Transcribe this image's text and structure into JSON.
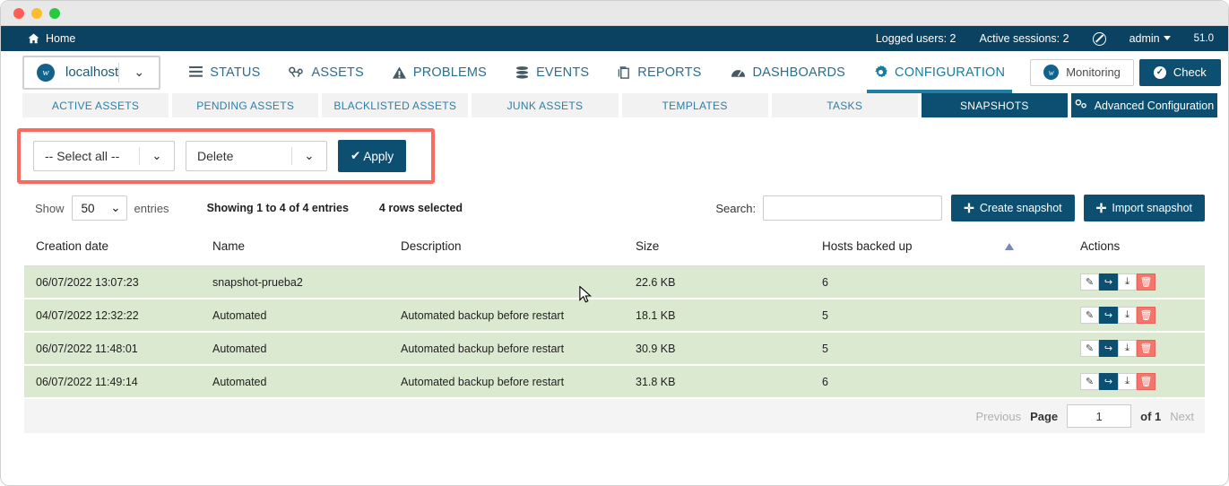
{
  "topbar": {
    "home": "Home",
    "logged_users": "Logged users: 2",
    "active_sessions": "Active sessions: 2",
    "user": "admin",
    "version": "51.0"
  },
  "hostselect": {
    "name": "localhost",
    "logo": "w"
  },
  "nav": {
    "items": [
      {
        "label": "STATUS",
        "icon": "list-icon",
        "active": false
      },
      {
        "label": "ASSETS",
        "icon": "assets-icon",
        "active": false
      },
      {
        "label": "PROBLEMS",
        "icon": "warning-icon",
        "active": false
      },
      {
        "label": "EVENTS",
        "icon": "stack-icon",
        "active": false
      },
      {
        "label": "REPORTS",
        "icon": "report-icon",
        "active": false
      },
      {
        "label": "DASHBOARDS",
        "icon": "gauge-icon",
        "active": false
      },
      {
        "label": "CONFIGURATION",
        "icon": "gear-icon",
        "active": true
      }
    ],
    "monitoring_label": "Monitoring",
    "check_label": "Check"
  },
  "tabs": [
    {
      "label": "ACTIVE ASSETS",
      "active": false
    },
    {
      "label": "PENDING ASSETS",
      "active": false
    },
    {
      "label": "BLACKLISTED ASSETS",
      "active": false
    },
    {
      "label": "JUNK ASSETS",
      "active": false
    },
    {
      "label": "TEMPLATES",
      "active": false
    },
    {
      "label": "TASKS",
      "active": false
    },
    {
      "label": "SNAPSHOTS",
      "active": true
    }
  ],
  "advanced_tab": {
    "label": "Advanced Configuration",
    "icon": "gears-icon"
  },
  "bulkbar": {
    "select_all_value": "-- Select all --",
    "action_value": "Delete",
    "apply_label": "Apply",
    "highlight_color": "#fb6a5e"
  },
  "toolbar": {
    "show_label": "Show",
    "entries_value": "50",
    "entries_label": "entries",
    "showing_info": "Showing 1 to 4 of 4 entries",
    "rows_selected": "4 rows selected",
    "search_label": "Search:",
    "search_value": "",
    "create_snapshot": "Create snapshot",
    "import_snapshot": "Import snapshot"
  },
  "table": {
    "columns": [
      "Creation date",
      "Name",
      "Description",
      "Size",
      "Hosts backed up",
      "",
      "Actions"
    ],
    "sort_direction": "asc",
    "rows": [
      {
        "date": "06/07/2022 13:07:23",
        "name": "snapshot-prueba2",
        "description": "",
        "size": "22.6 KB",
        "hosts": "6"
      },
      {
        "date": "04/07/2022 12:32:22",
        "name": "Automated",
        "description": "Automated backup before restart",
        "size": "18.1 KB",
        "hosts": "5"
      },
      {
        "date": "06/07/2022 11:48:01",
        "name": "Automated",
        "description": "Automated backup before restart",
        "size": "30.9 KB",
        "hosts": "5"
      },
      {
        "date": "06/07/2022 11:49:14",
        "name": "Automated",
        "description": "Automated backup before restart",
        "size": "31.8 KB",
        "hosts": "6"
      }
    ],
    "row_actions": [
      "edit-icon",
      "restore-icon",
      "download-icon",
      "delete-icon"
    ]
  },
  "pagination": {
    "previous": "Previous",
    "page_label": "Page",
    "page_value": "1",
    "of_label": "of 1",
    "next": "Next"
  },
  "colors": {
    "nav_dark": "#0b4161",
    "accent": "#0d4f70",
    "row_green": "#dbe9d0",
    "danger": "#f4756b",
    "highlight": "#fb6a5e"
  }
}
